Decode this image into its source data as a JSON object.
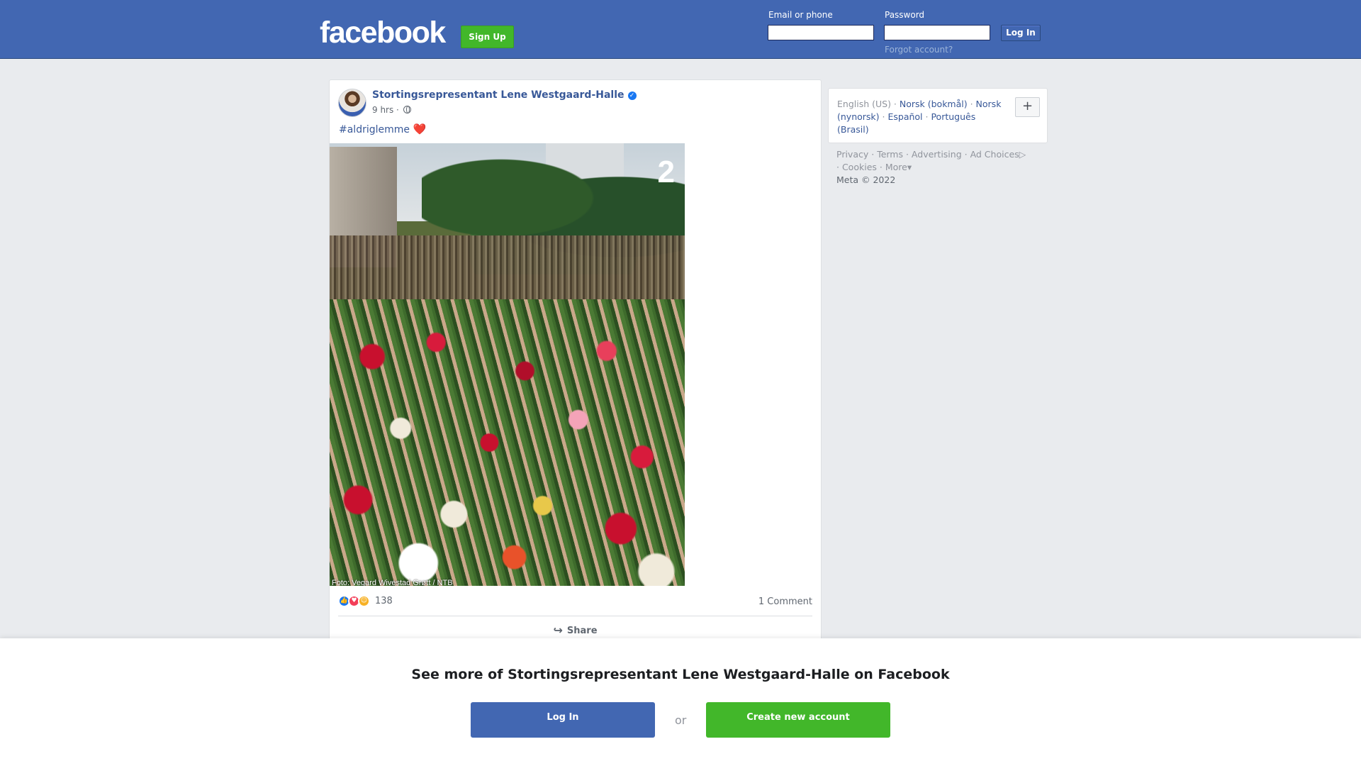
{
  "header": {
    "logo": "facebook",
    "signup_label": "Sign Up",
    "email_label": "Email or phone",
    "password_label": "Password",
    "login_label": "Log In",
    "forgot_label": "Forgot account?"
  },
  "post": {
    "author": "Stortingsrepresentant Lene Westgaard-Halle",
    "time": "9 hrs ·",
    "hashtag": "#aldriglemme",
    "emoji": "❤️",
    "photo_logo": "2",
    "photo_credit": "Foto: Vegard Wivestad Grøtt / NTB",
    "reaction_count": "138",
    "comments_label": "1 Comment",
    "share_label": "Share"
  },
  "languages": {
    "current": "English (US)",
    "items": [
      "Norsk (bokmål)",
      "Norsk (nynorsk)",
      "Español",
      "Português (Brasil)"
    ],
    "add_label": "+"
  },
  "footer": {
    "links": [
      "Privacy",
      "Terms",
      "Advertising",
      "Ad Choices",
      "Cookies",
      "More"
    ],
    "copyright": "Meta © 2022"
  },
  "overlay": {
    "title": "See more of Stortingsrepresentant Lene Westgaard-Halle on Facebook",
    "login_label": "Log In",
    "or_label": "or",
    "create_label": "Create new account"
  },
  "colors": {
    "brand_blue": "#4267b2",
    "green": "#42b72a",
    "link": "#385898",
    "background": "#e9ebee"
  }
}
